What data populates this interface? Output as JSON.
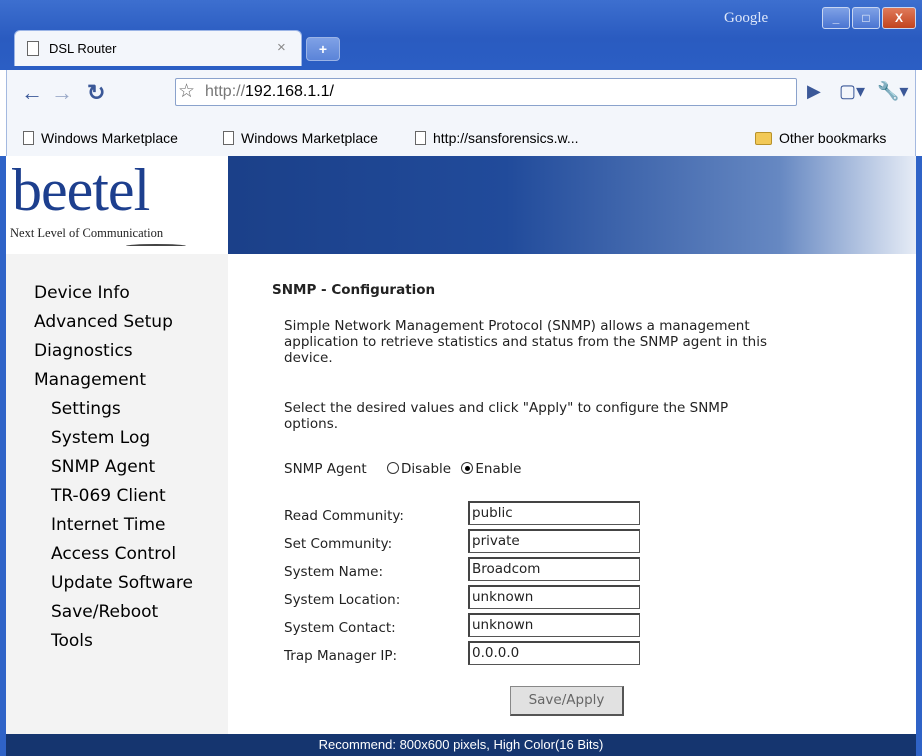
{
  "browser": {
    "search_label": "Google",
    "window_buttons": {
      "minimize": "_",
      "maximize": "□",
      "close": "X"
    },
    "tab": {
      "title": "DSL Router",
      "close_glyph": "×"
    },
    "new_tab_glyph": "+",
    "address": {
      "scheme": "http://",
      "host": "192.168.1.1/"
    },
    "bookmarks": [
      "Windows Marketplace",
      "Windows Marketplace",
      "http://sansforensics.w..."
    ],
    "other_bookmarks": "Other bookmarks"
  },
  "banner": {
    "logo_text": "beetel",
    "tagline": "Next Level of Communication"
  },
  "sidebar": {
    "items": [
      "Device Info",
      "Advanced Setup",
      "Diagnostics",
      "Management",
      "Settings",
      "System Log",
      "SNMP Agent",
      "TR-069 Client",
      "Internet Time",
      "Access Control",
      "Update Software",
      "Save/Reboot",
      "Tools"
    ]
  },
  "content": {
    "heading": "SNMP - Configuration",
    "description_lines": [
      "Simple Network Management Protocol (SNMP) allows a management",
      "application to retrieve statistics and status from the SNMP agent in this",
      "device."
    ],
    "instruction_lines": [
      "Select the desired values and click \"Apply\" to configure the SNMP",
      "options."
    ],
    "snmp_agent_label": "SNMP Agent",
    "disable_label": "Disable",
    "enable_label": "Enable",
    "snmp_agent_selected": "Enable",
    "fields": [
      {
        "label": "Read Community:",
        "value": "public"
      },
      {
        "label": "Set Community:",
        "value": "private"
      },
      {
        "label": "System Name:",
        "value": "Broadcom"
      },
      {
        "label": "System Location:",
        "value": "unknown"
      },
      {
        "label": "System Contact:",
        "value": "unknown"
      },
      {
        "label": "Trap Manager IP:",
        "value": "0.0.0.0"
      }
    ],
    "save_button": "Save/Apply"
  },
  "footer": "Recommend: 800x600 pixels, High Color(16 Bits)"
}
